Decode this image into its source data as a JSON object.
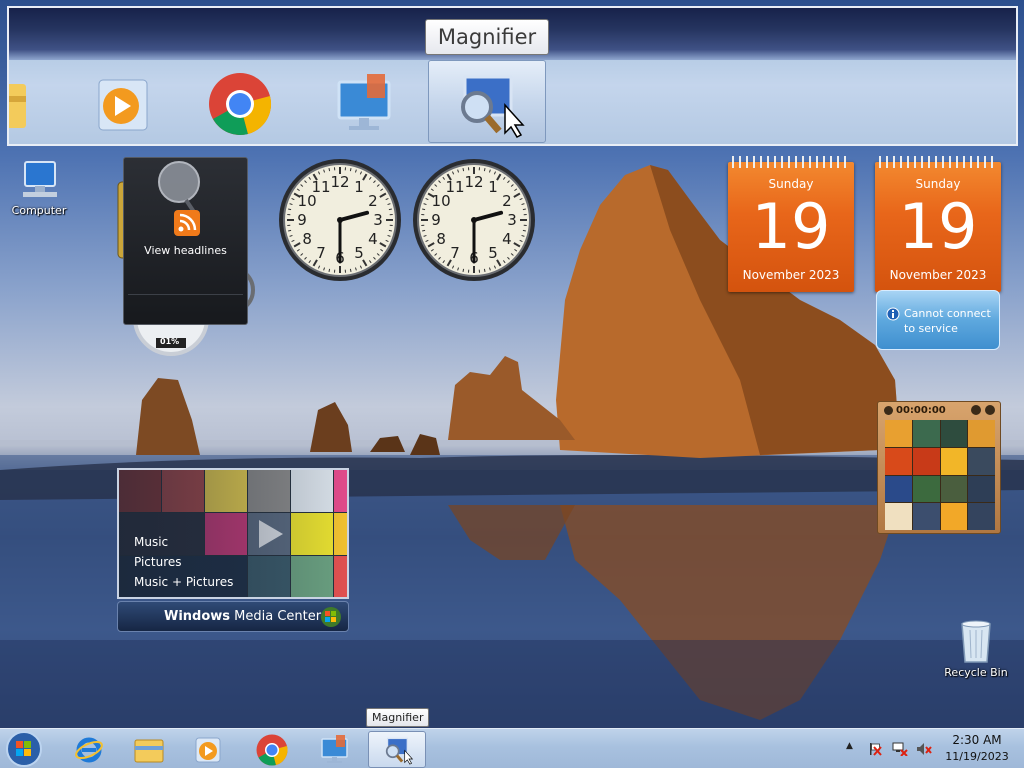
{
  "magnifier": {
    "tooltip": "Magnifier"
  },
  "desktop_icons": {
    "computer": "Computer",
    "recycle_bin": "Recycle Bin"
  },
  "feed_gadget": {
    "label": "View headlines"
  },
  "cpu_meter": {
    "value": "01%"
  },
  "clocks": [
    {
      "hour": 2,
      "minute": 30
    },
    {
      "hour": 2,
      "minute": 30
    }
  ],
  "calendars": [
    {
      "dow": "Sunday",
      "day": "19",
      "month": "November 2023"
    },
    {
      "dow": "Sunday",
      "day": "19",
      "month": "November 2023"
    }
  ],
  "weather": {
    "message_line1": "Cannot connect",
    "message_line2": "to service"
  },
  "puzzle": {
    "timer": "00:00:00"
  },
  "media_center": {
    "menu": [
      "Music",
      "Pictures",
      "Music + Pictures"
    ],
    "title_bold": "Windows",
    "title_rest": " Media Center"
  },
  "taskbar": {
    "tooltip": "Magnifier",
    "time": "2:30 AM",
    "date": "11/19/2023"
  },
  "colors": {
    "calendar_orange": "#e8661a",
    "taskbar": "#a8c1df"
  }
}
